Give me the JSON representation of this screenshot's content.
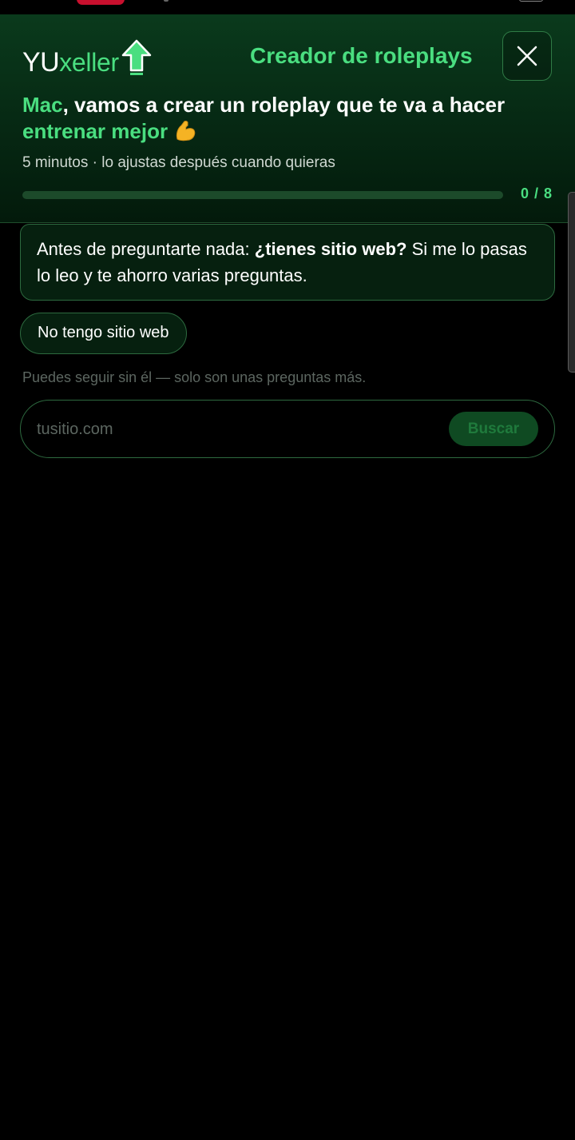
{
  "brand": {
    "part1": "YU",
    "part2": "xeller"
  },
  "header": {
    "title": "Creador de roleplays",
    "headline": {
      "name": "Mac",
      "text1": ", vamos a crear un roleplay que te va a hacer ",
      "highlight": "entrenar mejor"
    },
    "subline": "5 minutos · lo ajustas después cuando quieras",
    "progress": {
      "current": 0,
      "total": 8,
      "label": "0 / 8",
      "fraction": 0
    }
  },
  "chat": {
    "message_part1": "Antes de preguntarte nada: ",
    "message_bold": "¿tienes sitio web?",
    "message_part2": " Si me lo pasas lo leo y te ahorro varias preguntas."
  },
  "chip": {
    "label": "No tengo sitio web"
  },
  "hint": "Puedes seguir sin él — solo son unas preguntas más.",
  "search": {
    "placeholder": "tusitio.com",
    "value": "",
    "button_label": "Buscar"
  },
  "colors": {
    "accent": "#4ade80",
    "background": "#000000",
    "header_bg": "#0a3a1c",
    "border": "#2d6a3f"
  },
  "icons": {
    "close": "close-icon",
    "logo_arrow": "up-arrow-icon",
    "emoji": "flexed-biceps-icon"
  }
}
